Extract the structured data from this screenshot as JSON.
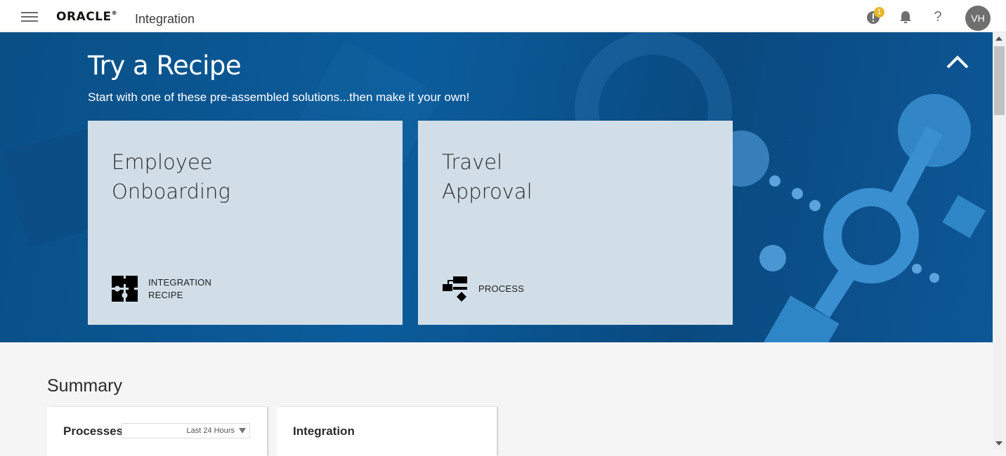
{
  "header": {
    "logo_text": "ORACLE",
    "logo_mark": "®",
    "app_name": "Integration",
    "notification_badge": "1",
    "help_label": "?",
    "user_initials": "VH"
  },
  "hero": {
    "title": "Try a Recipe",
    "subtitle": "Start with one of these pre-assembled solutions...then make it your own!",
    "cards": [
      {
        "title_line1": "Employee",
        "title_line2": "Onboarding",
        "type_line1": "INTEGRATION",
        "type_line2": "RECIPE",
        "icon": "puzzle-icon"
      },
      {
        "title_line1": "Travel",
        "title_line2": "Approval",
        "type_line1": "PROCESS",
        "type_line2": "",
        "icon": "process-flow-icon"
      }
    ]
  },
  "summary": {
    "title": "Summary",
    "panels": [
      {
        "title": "Processes",
        "select_value": "Last 24 Hours"
      },
      {
        "title": "Integration"
      }
    ]
  },
  "colors": {
    "hero_bg": "#0b5c9c",
    "card_bg": "#d2dee7",
    "badge": "#e8b62a",
    "avatar": "#6f6f6f"
  }
}
